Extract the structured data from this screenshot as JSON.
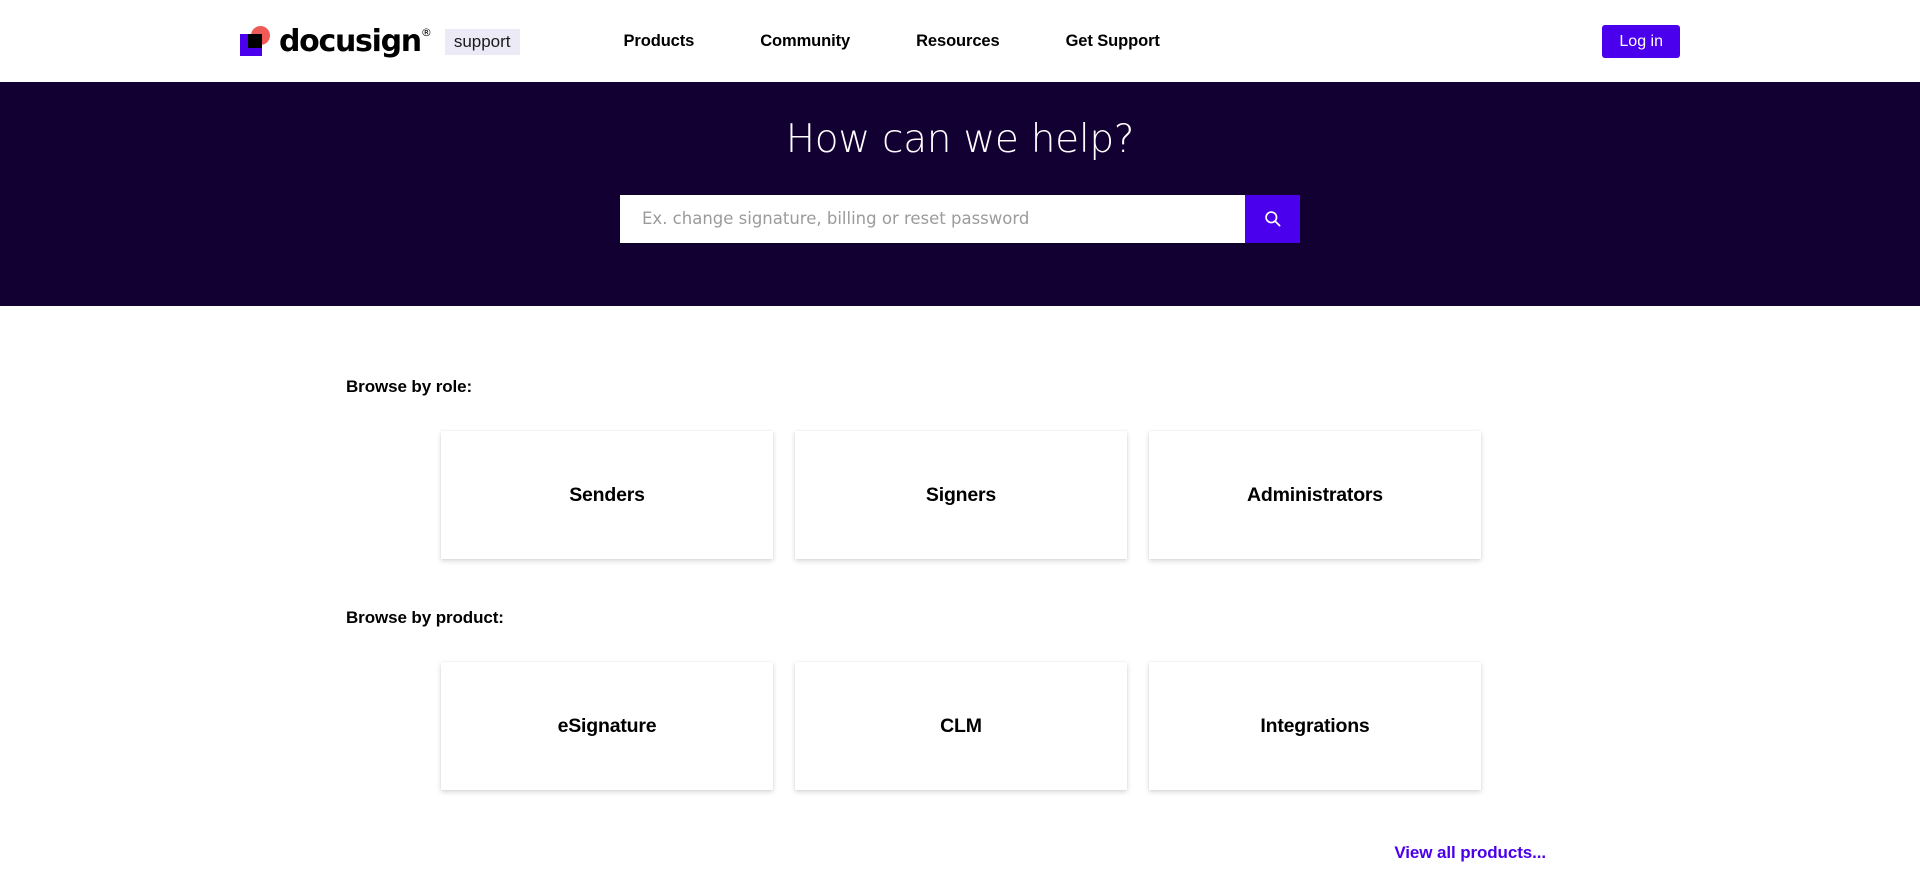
{
  "header": {
    "logo": {
      "wordmark": "docusign",
      "trademark": "®",
      "badge": "support",
      "mark_colors": {
        "red": "#f05a56",
        "purple": "#4b00ed",
        "black": "#000000"
      }
    },
    "nav": [
      {
        "label": "Products"
      },
      {
        "label": "Community"
      },
      {
        "label": "Resources"
      },
      {
        "label": "Get Support"
      }
    ],
    "login_label": "Log in",
    "accent_color": "#4b00ed"
  },
  "hero": {
    "title": "How can we help?",
    "background_color": "#130032",
    "search": {
      "value": "",
      "placeholder": "Ex. change signature, billing or reset password",
      "button_icon": "search-icon",
      "button_color": "#4b00ed"
    }
  },
  "main": {
    "role_section": {
      "label": "Browse by role:",
      "cards": [
        {
          "title": "Senders"
        },
        {
          "title": "Signers"
        },
        {
          "title": "Administrators"
        }
      ]
    },
    "product_section": {
      "label": "Browse by product:",
      "cards": [
        {
          "title": "eSignature"
        },
        {
          "title": "CLM"
        },
        {
          "title": "Integrations"
        }
      ],
      "view_all_label": "View all products...",
      "view_all_color": "#4b00ed"
    }
  }
}
